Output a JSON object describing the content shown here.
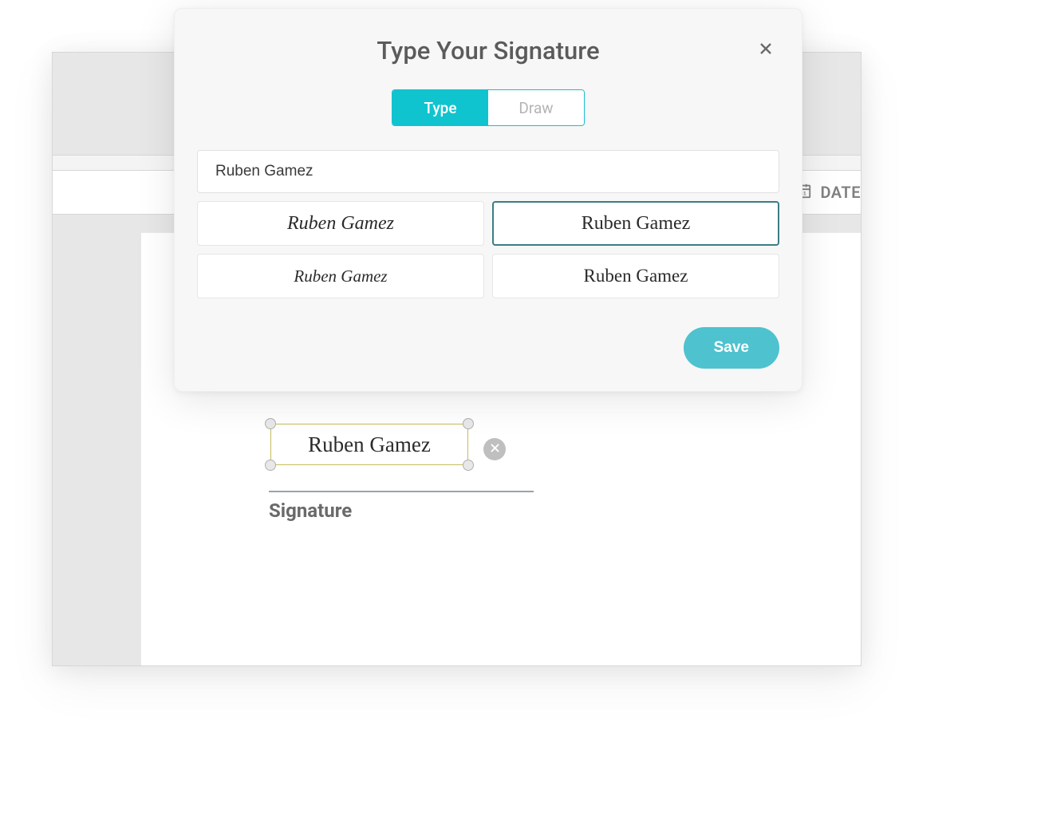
{
  "modal": {
    "title": "Type Your Signature",
    "tabs": {
      "type": "Type",
      "draw": "Draw"
    },
    "input_value": "Ruben Gamez",
    "styles": [
      {
        "preview": "Ruben Gamez",
        "selected": false
      },
      {
        "preview": "Ruben Gamez",
        "selected": true
      },
      {
        "preview": "Ruben Gamez",
        "selected": false
      },
      {
        "preview": "Ruben Gamez",
        "selected": false
      }
    ],
    "save_label": "Save"
  },
  "toolbar": {
    "date_label": "DATE"
  },
  "placed_signature": {
    "text": "Ruben Gamez",
    "field_label": "Signature"
  },
  "colors": {
    "primary": "#10c4cf",
    "primary_soft": "#4ec2cf",
    "selected_border": "#3a7e84",
    "resize_border": "#c7bc5b"
  }
}
